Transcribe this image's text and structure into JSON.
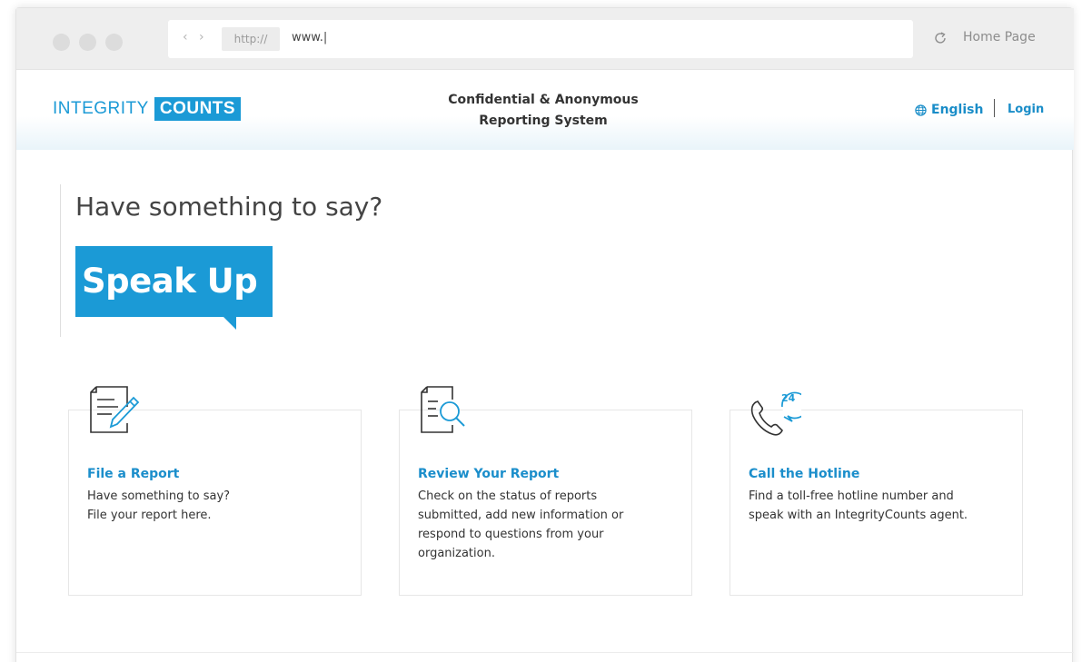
{
  "browser": {
    "protocol": "http://",
    "url": "www.|",
    "nav_arrows": "‹ ›",
    "home_page_label": "Home Page"
  },
  "header": {
    "logo_part1": "INTEGRITY",
    "logo_part2": "COUNTS",
    "tagline_line1": "Confidential & Anonymous",
    "tagline_line2": "Reporting System",
    "language_label": "English",
    "login_label": "Login"
  },
  "hero": {
    "title": "Have something to say?",
    "badge": "Speak Up"
  },
  "cards": [
    {
      "icon": "document-pen-icon",
      "title": "File a Report",
      "text": "Have something to say?\nFile your report here."
    },
    {
      "icon": "document-search-icon",
      "title": "Review Your Report",
      "text": "Check on the status of reports\nsubmitted, add new information or\nrespond to questions from your\norganization."
    },
    {
      "icon": "phone-24-icon",
      "title": "Call the Hotline",
      "text": "Find a toll-free hotline number and\nspeak with an IntegrityCounts agent."
    }
  ],
  "colors": {
    "brand_blue": "#1b9ad6",
    "link_blue": "#1a8dc8"
  }
}
